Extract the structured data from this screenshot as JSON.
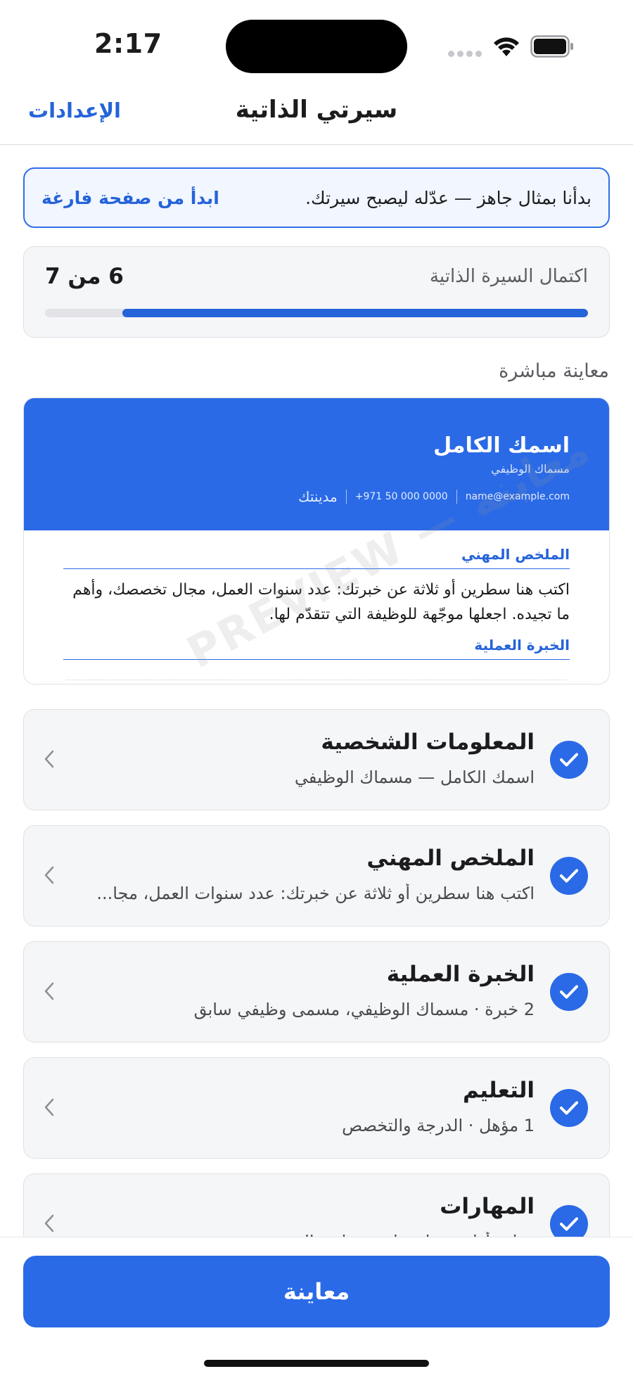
{
  "status": {
    "time": "2:17"
  },
  "nav": {
    "title": "سيرتي الذاتية",
    "settings": "الإعدادات"
  },
  "banner": {
    "text": "بدأنا بمثال جاهز — عدّله ليصبح سيرتك.",
    "link": "ابدأ من صفحة فارغة"
  },
  "progress": {
    "label": "اكتمال السيرة الذاتية",
    "count": "6 من 7",
    "completed": 6,
    "total": 7
  },
  "live_preview": {
    "label": "معاينة مباشرة",
    "watermark": "PREVIEW — معاينة",
    "name": "اسمك الكامل",
    "job_title": "مسماك الوظيفي",
    "email": "name@example.com",
    "phone": "+971 50 000 0000",
    "city": "مدينتك",
    "summary_heading": "الملخص المهني",
    "summary_text": "اكتب هنا سطرين أو ثلاثة عن خبرتك: عدد سنوات العمل، مجال تخصصك، وأهم ما تجيده. اجعلها موجّهة للوظيفة التي تتقدّم لها.",
    "experience_heading": "الخبرة العملية"
  },
  "sections": [
    {
      "title": "المعلومات الشخصية",
      "subtitle": "اسمك الكامل — مسماك الوظيفي",
      "complete": true
    },
    {
      "title": "الملخص المهني",
      "subtitle": "اكتب هنا سطرين أو ثلاثة عن خبرتك: عدد سنوات العمل، مجا...",
      "complete": true
    },
    {
      "title": "الخبرة العملية",
      "subtitle": "2 خبرة · مسماك الوظيفي، مسمى وظيفي سابق",
      "complete": true
    },
    {
      "title": "التعليم",
      "subtitle": "1 مؤهل · الدرجة والتخصص",
      "complete": true
    },
    {
      "title": "المهارات",
      "subtitle": "مهارة أولى، مهارة ثانية، مهارة ثالثة",
      "complete": true
    }
  ],
  "bottom": {
    "button_label": "معاينة"
  },
  "colors": {
    "accent": "#2a6ae6",
    "link": "#2563d9"
  },
  "icons": {
    "check": "checkmark-icon",
    "chevron": "chevron-left-icon"
  }
}
